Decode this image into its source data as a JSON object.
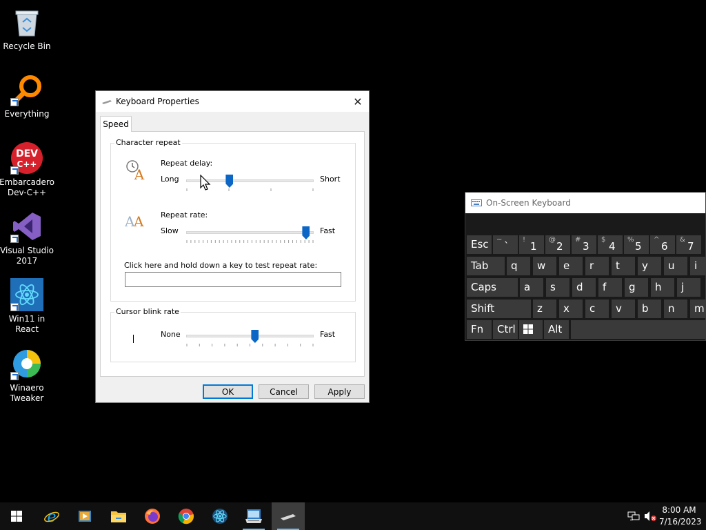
{
  "desktop": {
    "icons": [
      {
        "label": "Recycle Bin",
        "icon": "recycle-bin-icon"
      },
      {
        "label": "Everything",
        "icon": "everything-search-icon"
      },
      {
        "label": "Embarcadero\nDev-C++",
        "icon": "devcpp-icon"
      },
      {
        "label": "Visual Studio\n2017",
        "icon": "visual-studio-icon"
      },
      {
        "label": "Win11 in\nReact",
        "icon": "react-icon"
      },
      {
        "label": "Winaero\nTweaker",
        "icon": "winaero-icon"
      }
    ]
  },
  "dialog": {
    "title": "Keyboard Properties",
    "tab": "Speed",
    "character_repeat": {
      "group_title": "Character repeat",
      "repeat_delay": {
        "label": "Repeat delay:",
        "min_label": "Long",
        "max_label": "Short",
        "value_fraction": 0.34
      },
      "repeat_rate": {
        "label": "Repeat rate:",
        "min_label": "Slow",
        "max_label": "Fast",
        "value_fraction": 0.94
      },
      "test_label": "Click here and hold down a key to test repeat rate:",
      "test_value": ""
    },
    "cursor_blink": {
      "group_title": "Cursor blink rate",
      "min_label": "None",
      "max_label": "Fast",
      "value_fraction": 0.54
    },
    "buttons": {
      "ok": "OK",
      "cancel": "Cancel",
      "apply": "Apply"
    }
  },
  "osk": {
    "title": "On-Screen Keyboard",
    "rows": [
      [
        {
          "k": "Esc"
        },
        {
          "s": "~",
          "m": "`"
        },
        {
          "s": "!",
          "m": "1"
        },
        {
          "s": "@",
          "m": "2"
        },
        {
          "s": "#",
          "m": "3"
        },
        {
          "s": "$",
          "m": "4"
        },
        {
          "s": "%",
          "m": "5"
        },
        {
          "s": "^",
          "m": "6"
        },
        {
          "s": "&",
          "m": "7"
        }
      ],
      [
        {
          "k": "Tab"
        },
        {
          "k": "q"
        },
        {
          "k": "w"
        },
        {
          "k": "e"
        },
        {
          "k": "r"
        },
        {
          "k": "t"
        },
        {
          "k": "y"
        },
        {
          "k": "u"
        },
        {
          "k": "i"
        }
      ],
      [
        {
          "k": "Caps"
        },
        {
          "k": "a"
        },
        {
          "k": "s"
        },
        {
          "k": "d"
        },
        {
          "k": "f"
        },
        {
          "k": "g"
        },
        {
          "k": "h"
        },
        {
          "k": "j"
        }
      ],
      [
        {
          "k": "Shift"
        },
        {
          "k": "z"
        },
        {
          "k": "x"
        },
        {
          "k": "c"
        },
        {
          "k": "v"
        },
        {
          "k": "b"
        },
        {
          "k": "n"
        },
        {
          "k": "m"
        }
      ],
      [
        {
          "k": "Fn"
        },
        {
          "k": "Ctrl"
        },
        {
          "k": "win"
        },
        {
          "k": "Alt"
        },
        {
          "k": ""
        }
      ]
    ]
  },
  "taskbar": {
    "apps": [
      "start-icon",
      "internet-explorer-icon",
      "media-player-icon",
      "file-explorer-icon",
      "firefox-icon",
      "chrome-icon",
      "react-icon",
      "control-panel-icon",
      "keyboard-properties-icon"
    ],
    "clock_time": "8:00 AM",
    "clock_date": "7/16/2023"
  }
}
